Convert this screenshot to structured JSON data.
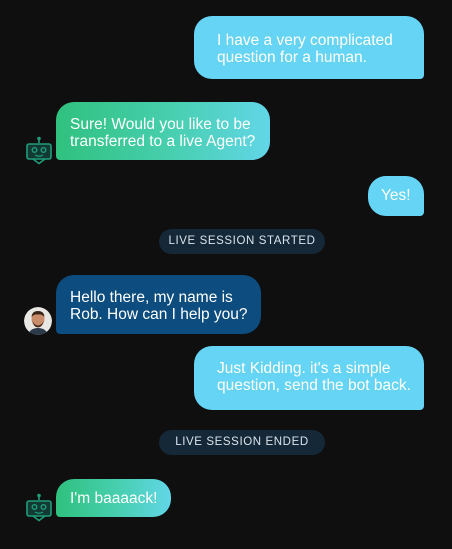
{
  "messages": [
    {
      "sender": "user",
      "lines": [
        "I have a very complicated",
        "question for a human."
      ]
    },
    {
      "sender": "bot",
      "lines": [
        "Sure! Would you like to be",
        "transferred to a live Agent?"
      ]
    },
    {
      "sender": "user",
      "lines": [
        "Yes!"
      ]
    },
    {
      "sender": "agent",
      "lines": [
        "Hello there, my name is",
        "Rob. How can I help you?"
      ]
    },
    {
      "sender": "user",
      "lines": [
        "Just Kidding. it's a simple",
        "question, send the bot back."
      ]
    },
    {
      "sender": "bot",
      "lines": [
        "I'm baaaack!"
      ]
    }
  ],
  "events": {
    "session_started": "LIVE SESSION STARTED",
    "session_ended": "LIVE SESSION ENDED"
  },
  "avatars": {
    "bot_icon": "robot-icon",
    "agent_icon": "agent-avatar"
  },
  "colors": {
    "background": "#0f0f10",
    "user_bubble": "#66d4f5",
    "bot_gradient_start": "#2fc17e",
    "bot_gradient_end": "#62d6e8",
    "agent_bubble": "#0c4c7f",
    "event_pill": "#152838",
    "bot_icon": "#1f9e7a"
  }
}
